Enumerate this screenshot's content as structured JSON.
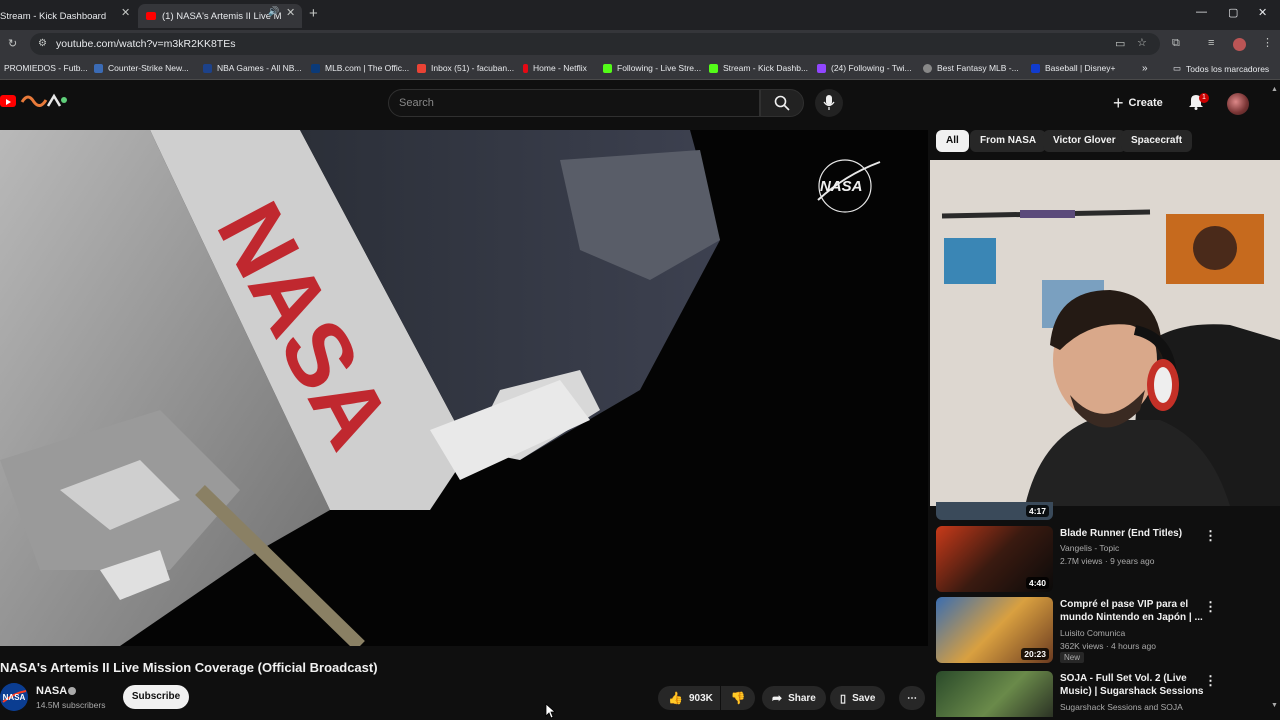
{
  "browser": {
    "tabs": [
      {
        "title": "Stream - Kick Dashboard",
        "active": false
      },
      {
        "title": "(1) NASA's Artemis II Live M",
        "active": true
      }
    ],
    "url": "youtube.com/watch?v=m3kR2KK8TEs",
    "bookmarks": [
      {
        "label": "PROMIEDOS - Futb...",
        "color": "#2e7d32"
      },
      {
        "label": "Counter-Strike New...",
        "color": "#3b6bb5"
      },
      {
        "label": "NBA Games - All NB...",
        "color": "#1d428a"
      },
      {
        "label": "MLB.com | The Offic...",
        "color": "#0b3a78"
      },
      {
        "label": "Inbox (51) - facuban...",
        "color": "#ea4335"
      },
      {
        "label": "Home - Netflix",
        "color": "#e50914"
      },
      {
        "label": "Following - Live Stre...",
        "color": "#53fc18"
      },
      {
        "label": "Stream - Kick Dashb...",
        "color": "#53fc18"
      },
      {
        "label": "(24) Following - Twi...",
        "color": "#9146ff"
      },
      {
        "label": "Best Fantasy MLB -...",
        "color": "#888888"
      },
      {
        "label": "Baseball | Disney+",
        "color": "#113ccf"
      }
    ],
    "all_bookmarks": "Todos los marcadores"
  },
  "youtube": {
    "search_placeholder": "Search",
    "create_label": "Create",
    "notification_count": "1"
  },
  "chips": [
    "All",
    "From NASA",
    "Victor Glover",
    "Spacecraft"
  ],
  "video": {
    "title": "NASA's Artemis II Live Mission Coverage (Official Broadcast)",
    "channel": "NASA",
    "subscribers": "14.5M subscribers",
    "subscribe_label": "Subscribe",
    "likes": "903K",
    "share_label": "Share",
    "save_label": "Save",
    "watermark": "NASA"
  },
  "recommendations": [
    {
      "title": "",
      "meta1": "",
      "meta2": "",
      "duration": "4:17"
    },
    {
      "title": "Blade Runner (End Titles)",
      "meta1": "Vangelis - Topic",
      "meta2": "2.7M views · 9 years ago",
      "duration": "4:40"
    },
    {
      "title": "Compré el pase VIP para el mundo Nintendo en Japón | ...",
      "meta1": "Luisito Comunica",
      "meta2": "362K views · 4 hours ago",
      "duration": "20:23",
      "badge": "New"
    },
    {
      "title": "SOJA - Full Set Vol. 2 (Live Music) | Sugarshack Sessions",
      "meta1": "Sugarshack Sessions and SOJA",
      "meta2": "",
      "duration": ""
    }
  ],
  "colors": {
    "youtube_red": "#ff0000",
    "background": "#0f0f0f",
    "chip_active": "#f1f1f1"
  }
}
